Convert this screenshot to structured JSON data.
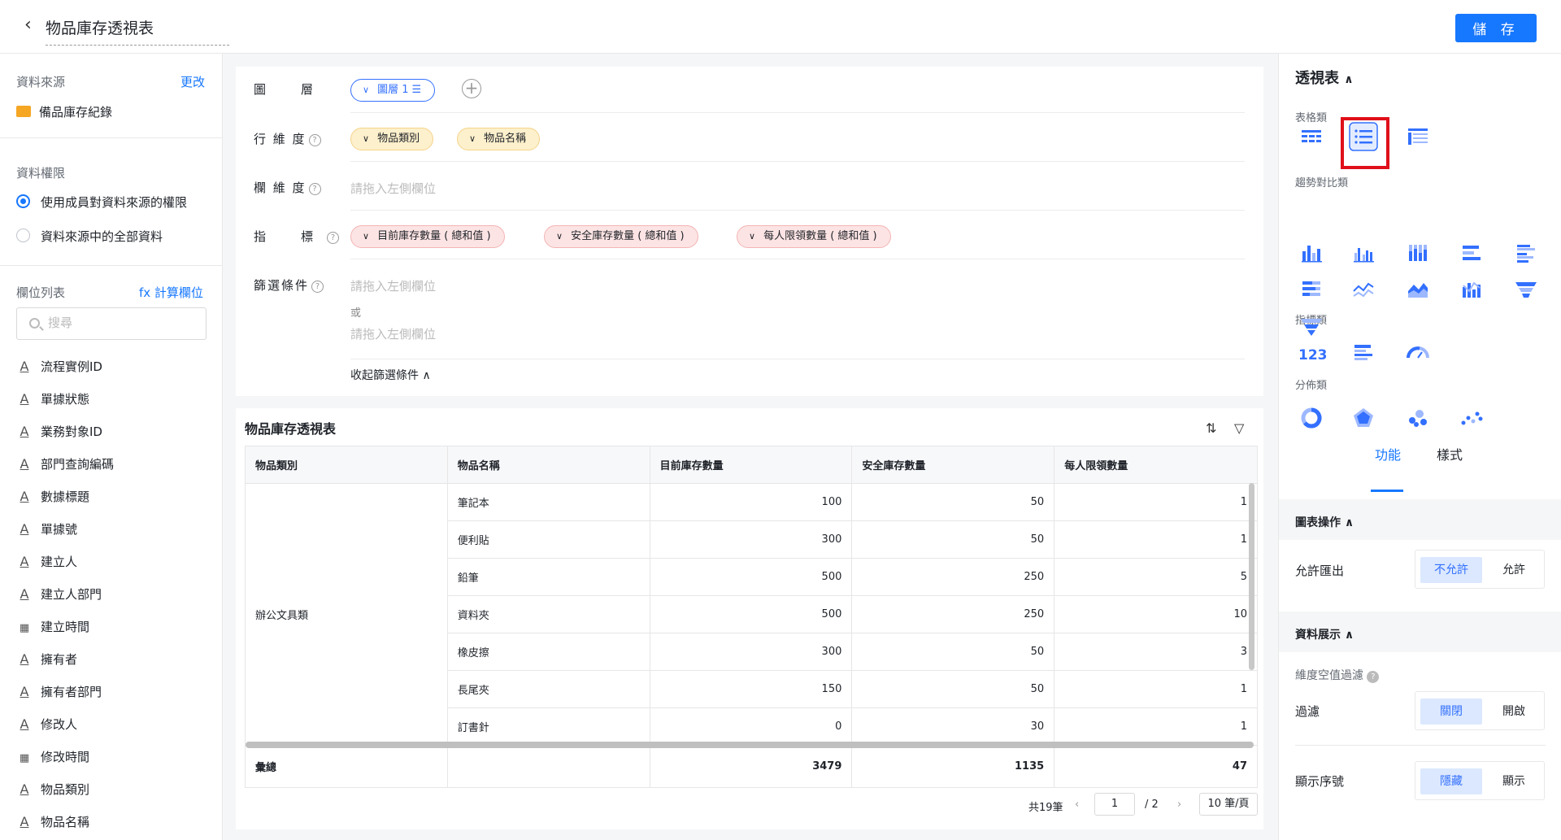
{
  "header": {
    "title": "物品庫存透視表",
    "save_label": "儲 存"
  },
  "left": {
    "source_label": "資料來源",
    "source_change": "更改",
    "source_name": "備品庫存紀錄",
    "perm_label": "資料權限",
    "perm_options": [
      "使用成員對資料來源的權限",
      "資料來源中的全部資料"
    ],
    "fields_label": "欄位列表",
    "calc_field": "fx 計算欄位",
    "search_placeholder": "搜尋",
    "fields": [
      {
        "icon": "A",
        "name": "流程實例ID"
      },
      {
        "icon": "A",
        "name": "單據狀態"
      },
      {
        "icon": "A",
        "name": "業務對象ID"
      },
      {
        "icon": "A",
        "name": "部門查詢編碼"
      },
      {
        "icon": "A",
        "name": "數據標題"
      },
      {
        "icon": "A",
        "name": "單據號"
      },
      {
        "icon": "A",
        "name": "建立人"
      },
      {
        "icon": "A",
        "name": "建立人部門"
      },
      {
        "icon": "cal",
        "name": "建立時間"
      },
      {
        "icon": "A",
        "name": "擁有者"
      },
      {
        "icon": "A",
        "name": "擁有者部門"
      },
      {
        "icon": "A",
        "name": "修改人"
      },
      {
        "icon": "cal",
        "name": "修改時間"
      },
      {
        "icon": "A",
        "name": "物品類別"
      },
      {
        "icon": "A",
        "name": "物品名稱"
      }
    ]
  },
  "config": {
    "layer_label": "圖　層",
    "layer_pill": "圖層 1",
    "row_label": "行 維 度",
    "row_pills": [
      "物品類別",
      "物品名稱"
    ],
    "col_label": "欄 維 度",
    "col_placeholder": "請拖入左側欄位",
    "metric_label": "指　標",
    "metric_pills": [
      "目前庫存數量 ( 總和值 )",
      "安全庫存數量 ( 總和值 )",
      "每人限領數量 ( 總和值 )"
    ],
    "filter_label": "篩選條件",
    "filter_placeholder": "請拖入左側欄位",
    "filter_or": "或",
    "filter_placeholder2": "請拖入左側欄位",
    "collapse_label": "收起篩選條件"
  },
  "pivot": {
    "title": "物品庫存透視表",
    "headers": [
      "物品類別",
      "物品名稱",
      "目前庫存數量",
      "安全庫存數量",
      "每人限領數量"
    ],
    "category": "辦公文具類",
    "rows": [
      {
        "name": "筆記本",
        "stock": "100",
        "safe": "50",
        "limit": "1"
      },
      {
        "name": "便利貼",
        "stock": "300",
        "safe": "50",
        "limit": "1"
      },
      {
        "name": "鉛筆",
        "stock": "500",
        "safe": "250",
        "limit": "5"
      },
      {
        "name": "資料夾",
        "stock": "500",
        "safe": "250",
        "limit": "10"
      },
      {
        "name": "橡皮擦",
        "stock": "300",
        "safe": "50",
        "limit": "3"
      },
      {
        "name": "長尾夾",
        "stock": "150",
        "safe": "50",
        "limit": "1"
      },
      {
        "name": "訂書針",
        "stock": "0",
        "safe": "30",
        "limit": "1"
      }
    ],
    "total": {
      "label": "彙總",
      "stock": "3479",
      "safe": "1135",
      "limit": "47"
    },
    "pager": {
      "total": "共19筆",
      "page": "1",
      "of": "/ 2",
      "size": "10 筆/頁"
    }
  },
  "right": {
    "title": "透視表",
    "groups": [
      "表格類",
      "趨勢對比類",
      "指標類",
      "分佈類"
    ],
    "tabs": [
      "功能",
      "樣式"
    ],
    "sec_chart_ops": "圖表操作",
    "allow_export": "允許匯出",
    "export_opts": [
      "不允許",
      "允許"
    ],
    "sec_data_display": "資料展示",
    "dim_null_filter": "維度空值過濾",
    "filter_label": "過濾",
    "filter_opts": [
      "關閉",
      "開啟"
    ],
    "show_index": "顯示序號",
    "index_opts": [
      "隱藏",
      "顯示"
    ]
  },
  "colors": {
    "accent": "#1677ff",
    "highlight": "#e0101a"
  }
}
